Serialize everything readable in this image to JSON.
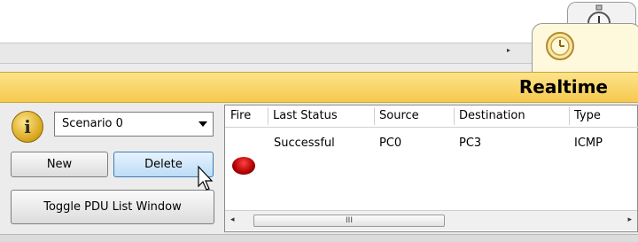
{
  "realtime_tab": {
    "label": "Realtime"
  },
  "info_icon": {
    "glyph": "i"
  },
  "scenario": {
    "selected": "Scenario 0"
  },
  "buttons": {
    "new": "New",
    "delete": "Delete",
    "toggle": "Toggle PDU List Window"
  },
  "pdu_table": {
    "headers": [
      "Fire",
      "Last Status",
      "Source",
      "Destination",
      "Type"
    ],
    "rows": [
      {
        "fire": "red",
        "last_status": "Successful",
        "source": "PC0",
        "destination": "PC3",
        "type": "ICMP"
      }
    ]
  },
  "scrollbar": {
    "left_arrow": "◂",
    "right_arrow": "▸",
    "thumb_grip": "III"
  },
  "nav_arrow": "▸",
  "colors": {
    "realtime_band": "#f6c94e",
    "delete_highlight": "#bcdcf6",
    "fire_red": "#d00000"
  }
}
